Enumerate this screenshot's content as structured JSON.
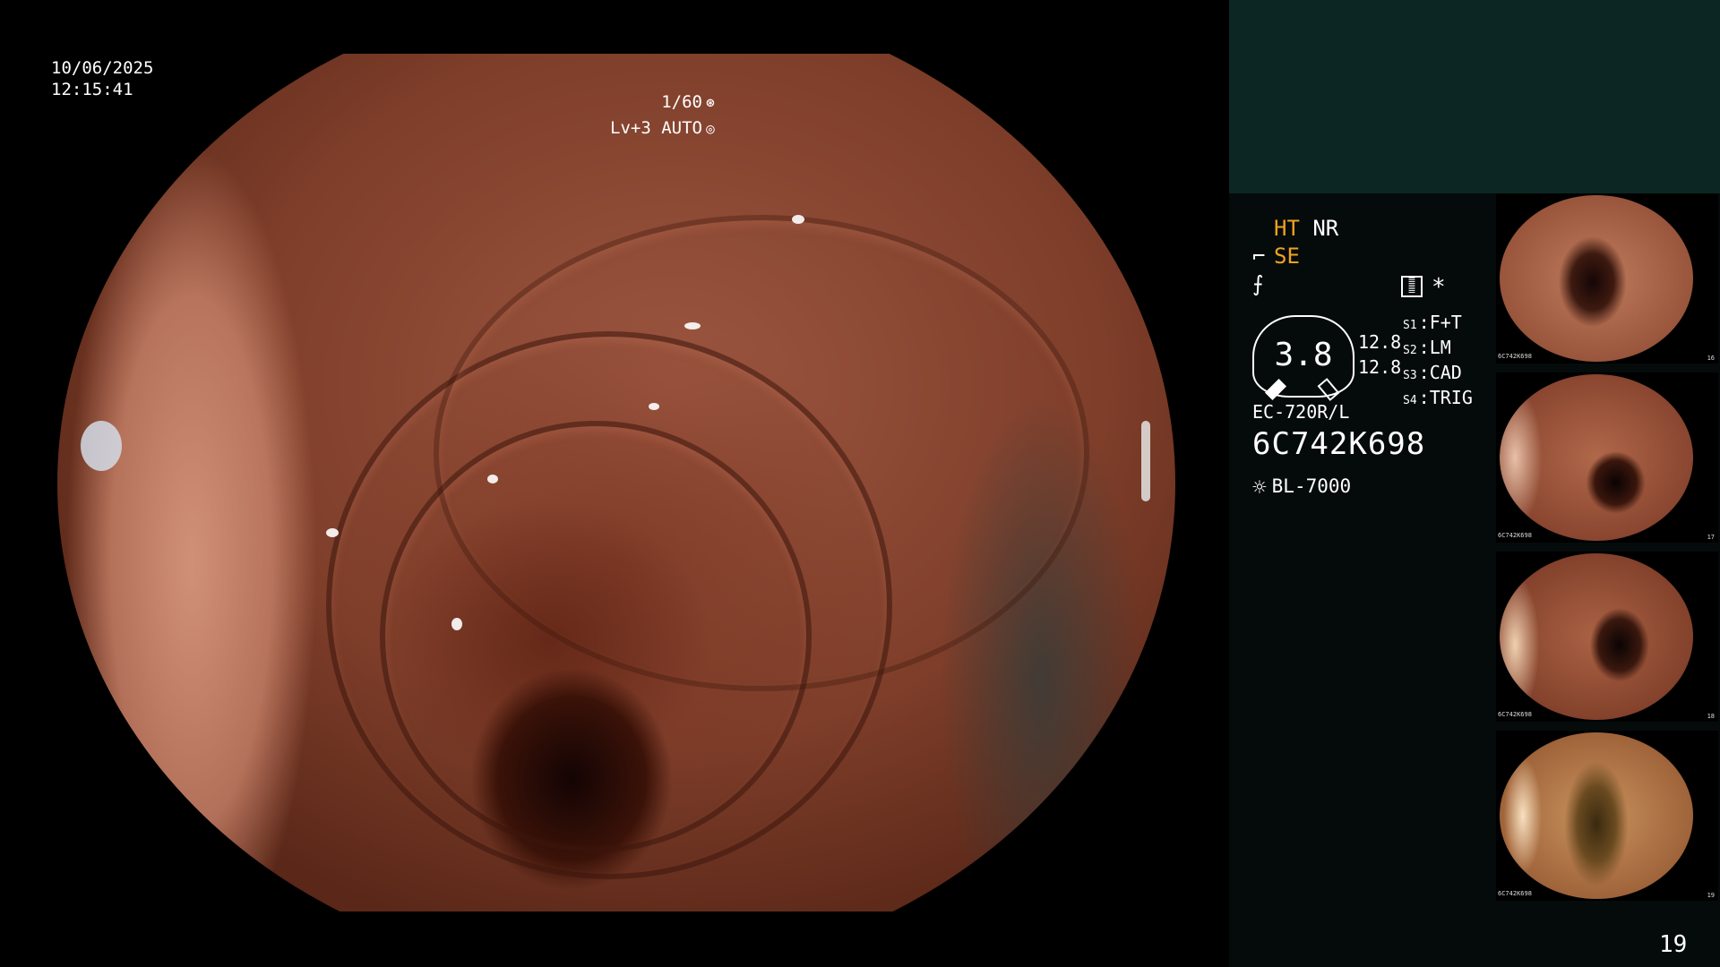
{
  "overlay": {
    "date": "10/06/2025",
    "time": "12:15:41",
    "shutter": "1/60",
    "shutter_icon": "shutter-icon",
    "level": "Lv+3",
    "iris_mode": "AUTO",
    "iris_icon": "iris-icon"
  },
  "panel": {
    "ht": "HT",
    "nr": "NR",
    "se": "SE",
    "se_icon": "enhance-icon",
    "freeze_icon": "freeze-icon",
    "gauge_value": "3.8",
    "gauge_reading_1": "12.8",
    "gauge_reading_2": "12.8",
    "settings": [
      {
        "slot": "S1",
        "label": "F+T"
      },
      {
        "slot": "S2",
        "label": "LM"
      },
      {
        "slot": "S3",
        "label": "CAD"
      },
      {
        "slot": "S4",
        "label": "TRIG"
      }
    ],
    "menu_icon": "menu-icon",
    "star_glyph": "*",
    "scope_model": "EC-720R/L",
    "scope_serial": "6C742K698",
    "light_icon": "light-source-icon",
    "light_source": "BL-7000"
  },
  "thumbnails": [
    {
      "serial": "6C742K698",
      "number": "16"
    },
    {
      "serial": "6C742K698",
      "number": "17"
    },
    {
      "serial": "6C742K698",
      "number": "18"
    },
    {
      "serial": "6C742K698",
      "number": "19"
    }
  ],
  "page_number": "19",
  "colors": {
    "accent_orange": "#f0a21e",
    "panel_top": "#0c2624",
    "panel_bg": "#050b0a"
  }
}
